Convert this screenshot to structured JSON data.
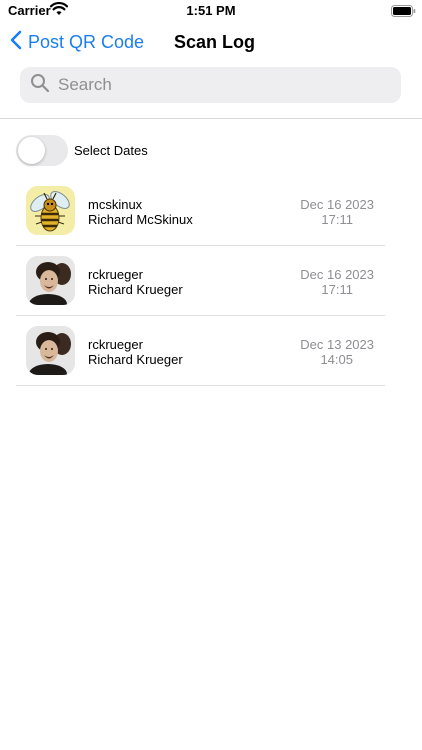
{
  "status_bar": {
    "carrier": "Carrier",
    "time": "1:51 PM"
  },
  "nav": {
    "back_label": "Post QR Code",
    "title": "Scan Log"
  },
  "search": {
    "placeholder": "Search",
    "value": ""
  },
  "toggle": {
    "label": "Select Dates",
    "on": false
  },
  "entries": [
    {
      "username": "mcskinux",
      "full_name": "Richard McSkinux",
      "date": "Dec 16 2023",
      "time": "17:11",
      "avatar": "bee-avatar-icon"
    },
    {
      "username": "rckrueger",
      "full_name": "Richard Krueger",
      "date": "Dec 16 2023",
      "time": "17:11",
      "avatar": "person-photo-avatar"
    },
    {
      "username": "rckrueger",
      "full_name": "Richard Krueger",
      "date": "Dec 13 2023",
      "time": "14:05",
      "avatar": "person-photo-avatar"
    }
  ],
  "colors": {
    "accent": "#1a7ef0",
    "secondary_text": "#8e8e93",
    "search_bg": "#eeeef0"
  }
}
